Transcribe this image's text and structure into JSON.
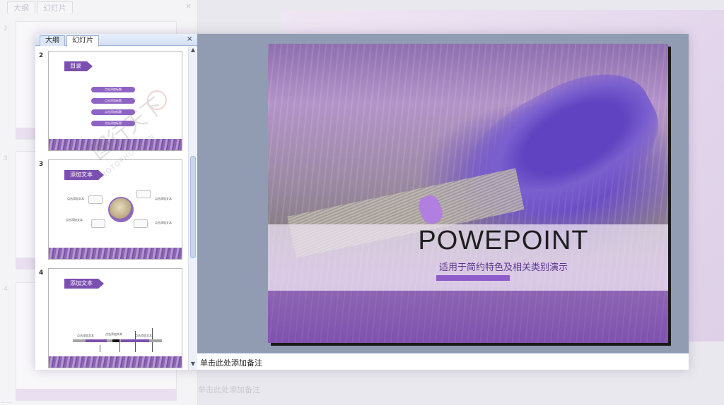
{
  "pane": {
    "tabs": [
      "大纲",
      "幻灯片"
    ],
    "close": "×"
  },
  "thumbnails": [
    {
      "number": "2",
      "flag": "目录",
      "items": [
        "点击添加标题",
        "点击添加标题",
        "点击添加标题",
        "点击添加标题"
      ]
    },
    {
      "number": "3",
      "flag": "添加文本",
      "labels": [
        "点击添加文本",
        "点击添加文本",
        "点击添加文本",
        "点击添加文本"
      ]
    },
    {
      "number": "4",
      "flag": "添加文本",
      "labels": [
        "点击添加文本",
        "点击添加文本",
        "点击添加文本"
      ]
    }
  ],
  "slide": {
    "title": "POWEPOINT",
    "subtitle": "适用于简约特色及相关类别演示"
  },
  "notes": {
    "placeholder": "单击此处添加备注"
  },
  "ghost": {
    "tabs": [
      "大纲",
      "幻灯片"
    ],
    "thumb_numbers": [
      "2",
      "3",
      "4"
    ],
    "notes": "单击此处添加备注"
  },
  "watermark": {
    "text": "图行天下",
    "sub": "PHOTOPHOTO.CN"
  },
  "colors": {
    "accent": "#7b4fb0",
    "edit_bg": "#919cb2",
    "selection": "#f0c040"
  }
}
